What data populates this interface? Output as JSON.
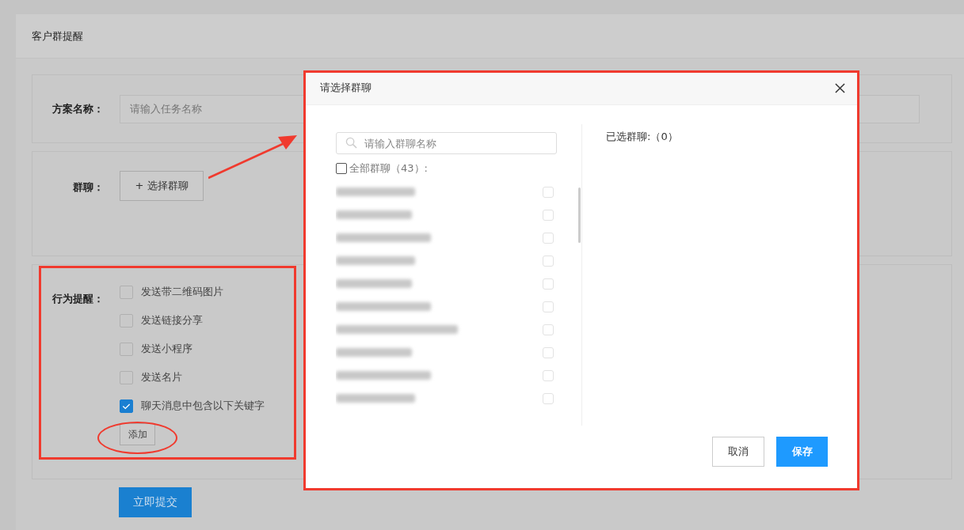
{
  "page": {
    "title": "客户群提醒"
  },
  "form": {
    "name_label": "方案名称：",
    "name_placeholder": "请输入任务名称",
    "group_label": "群聊：",
    "group_button": "+ 选择群聊",
    "behavior_label": "行为提醒：",
    "behaviors": [
      {
        "label": "发送带二维码图片",
        "checked": false
      },
      {
        "label": "发送链接分享",
        "checked": false
      },
      {
        "label": "发送小程序",
        "checked": false
      },
      {
        "label": "发送名片",
        "checked": false
      },
      {
        "label": "聊天消息中包含以下关键字",
        "checked": true
      }
    ],
    "add_button": "添加",
    "submit_button": "立即提交"
  },
  "dialog": {
    "title": "请选择群聊",
    "search_placeholder": "请输入群聊名称",
    "select_all": {
      "label": "全部群聊（43）:",
      "checked": false
    },
    "groups": [
      {
        "checked": false
      },
      {
        "checked": false
      },
      {
        "checked": false
      },
      {
        "checked": false
      },
      {
        "checked": false
      },
      {
        "checked": false
      },
      {
        "checked": false
      },
      {
        "checked": false
      },
      {
        "checked": false
      },
      {
        "checked": false
      }
    ],
    "selected_label": "已选群聊:（0）",
    "cancel_button": "取消",
    "save_button": "保存"
  },
  "annotations": [
    {
      "kind": "frame"
    },
    {
      "kind": "ellipse"
    },
    {
      "kind": "arrow"
    },
    {
      "kind": "frame"
    }
  ]
}
